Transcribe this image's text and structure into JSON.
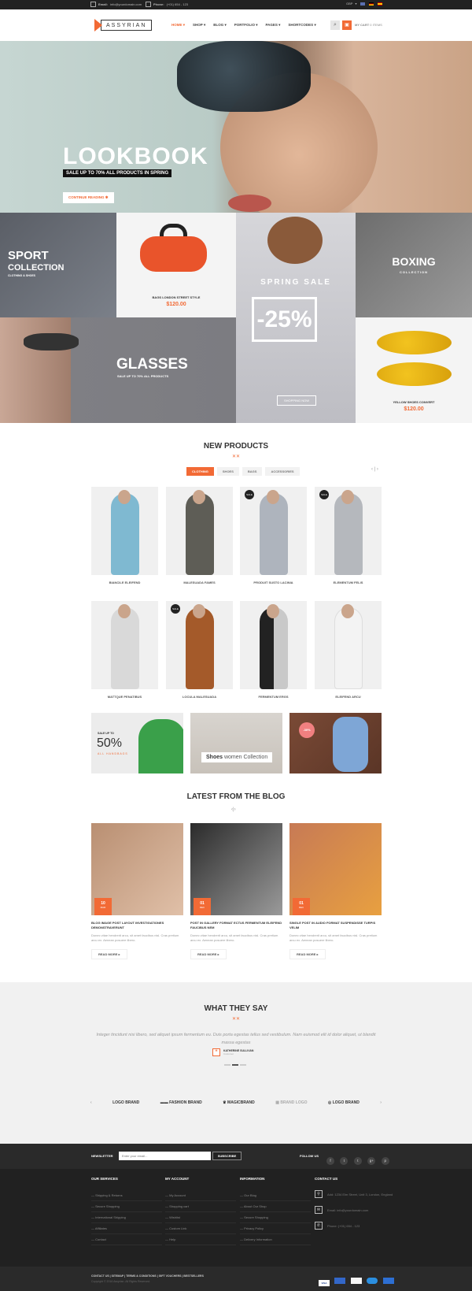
{
  "topbar": {
    "email_label": "Email:",
    "email": "info@yourdomain.com",
    "phone_label": "Phone:",
    "phone": "(+01) 654 - 123",
    "currency": "GBP",
    "flags": [
      "uk",
      "germany",
      "spain"
    ]
  },
  "header": {
    "logo_text": "ASSYRIAN",
    "nav": [
      "HOME",
      "SHOP",
      "BLOG",
      "PORTFOLIO",
      "PAGES",
      "SHORTCODES"
    ],
    "active_nav": "HOME",
    "cart_text": "MY CART",
    "cart_value": "0 ITEMS"
  },
  "hero": {
    "title": "LOOKBOOK",
    "subtitle": "SALE UP TO 70% ALL PRODUCTS IN SPRING",
    "button": "CONTINUE READING"
  },
  "banners": {
    "sport_title": "SPORT",
    "sport_title2": "COLLECTION",
    "sport_sub": "CLOTHING & SHOES",
    "bag_name": "BAGS LONDON STREET STYLE",
    "bag_price": "$120.00",
    "spring_title": "SPRING SALE",
    "spring_discount": "-25%",
    "spring_button": "SHOPPING NOW",
    "boxing_title": "BOXING",
    "boxing_sub": "COLLECTION",
    "glasses_title": "GLASSES",
    "glasses_sub": "SALE UP TO 70% ALL PRODUCTS",
    "shoes_name": "YELLOW SHOES CONVERT",
    "shoes_price": "$120.00"
  },
  "new_products": {
    "title": "NEW PRODUCTS",
    "tabs": [
      "CLOTHING",
      "SHOES",
      "BAGS",
      "ACCESSORIES"
    ],
    "active_tab": "CLOTHING",
    "products": [
      {
        "name": "BIANCILE ELEIFEND",
        "badge": ""
      },
      {
        "name": "MALESUADA FAMES",
        "badge": ""
      },
      {
        "name": "PRODUIT SUSTO LACINIA",
        "badge": "SALE"
      },
      {
        "name": "ELEMENTUM FELIS",
        "badge": "SALE"
      },
      {
        "name": "MATTQUE PENATIBUS",
        "badge": ""
      },
      {
        "name": "LOCULA MALESUADA",
        "badge": "SALE"
      },
      {
        "name": "FERMENTUM ERGS",
        "badge": ""
      },
      {
        "name": "ELEIFEND ARCU",
        "badge": ""
      }
    ]
  },
  "promos": {
    "p1_small": "SALE UP TO",
    "p1_big": "50%",
    "p1_sub": "ALL HANDBAGS",
    "p2_bold": "Shoes",
    "p2_light": "women Collection",
    "p3_badge": "-30%"
  },
  "blog": {
    "title": "LATEST FROM THE BLOG",
    "posts": [
      {
        "day": "10",
        "month": "MAR",
        "title": "BLOG IMAGE POST LAYOUT INVESTIGATIONES DEMONSTRAVERUNT",
        "excerpt": "Donec vitae hendrerit arcu, sit amet faucibus nisl. Cras pretium arcu ex. Aenean posuere libero.",
        "more": "READ MORE"
      },
      {
        "day": "01",
        "month": "DEC",
        "title": "POST IN GALLERY FORMAT ECTUS FERMENTUM ELEIFEND FAUCIBUS NEM",
        "excerpt": "Donec vitae hendrerit arcu, sit amet faucibus nisl. Cras pretium arcu ex. Aenean posuere libero.",
        "more": "READ MORE"
      },
      {
        "day": "01",
        "month": "DEC",
        "title": "SINGLE POST IN AUDIO FORMAT SUSPENDISSE TURPIS VELIM",
        "excerpt": "Donec vitae hendrerit arcu, sit amet faucibus nisl. Cras pretium arcu ex. Aenean posuere libero.",
        "more": "READ MORE"
      }
    ]
  },
  "testimonials": {
    "title": "WHAT THEY SAY",
    "quote": "Integer tincidunt nisi libero, sed aliquet ipsum fermentum eu. Duis porta egestas tellus sed vestibulum. Nam euismod elit id dolor aliquet, ut blandit massa egestas",
    "author": "KATHERINE SULLIVAN",
    "role": "Customer"
  },
  "brands": [
    "LOGO BRAND",
    "FASHION BRAND",
    "MAGICBRAND",
    "BRAND LOGO",
    "LOGO BRAND"
  ],
  "newsletter": {
    "label": "NEWSLETTER",
    "placeholder": "Enter your email...",
    "button": "SUBSCRIBE",
    "follow": "FOLLOW US",
    "social": [
      "f",
      "t",
      "t",
      "g+",
      "p"
    ]
  },
  "footer": {
    "services_title": "OUR SERVICES",
    "services": [
      "Shipping & Returns",
      "Secure Shopping",
      "International Shipping",
      "Affiliates",
      "Contact"
    ],
    "account_title": "MY ACCOUNT",
    "account": [
      "My Account",
      "Shopping cart",
      "Wishlist",
      "Custom Link",
      "Help"
    ],
    "info_title": "INFORMATION",
    "info": [
      "Our Blog",
      "About Our Shop",
      "Secure Shopping",
      "Privacy Policy",
      "Delivery Information"
    ],
    "contact_title": "CONTACT US",
    "address": "Add: 1234 Elm Street, Unit 3, London, England",
    "email": "Email: info@yourdomain.com",
    "phone": "Phone: (+01) 654 - 123"
  },
  "footer_bottom": {
    "links": [
      "CONTACT US",
      "SITEMAP",
      "TERMS & CONDITIONS",
      "GIFT VOUCHERS",
      "BESTSELLERS"
    ],
    "copyright": "Copyright © 2016 Assyrian. All Rights Reserved.",
    "cards": [
      "VISA",
      "MAESTRO",
      "DISCOVER",
      "MASTERCARD",
      "AMEX"
    ]
  },
  "colors": {
    "accent": "#f26a35",
    "dark": "#212121"
  }
}
